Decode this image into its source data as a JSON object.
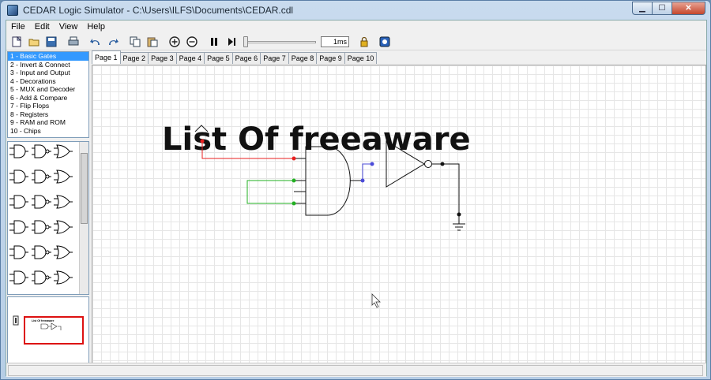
{
  "window": {
    "title": "CEDAR Logic Simulator - C:\\Users\\ILFS\\Documents\\CEDAR.cdl"
  },
  "menu": [
    "File",
    "Edit",
    "View",
    "Help"
  ],
  "toolbar": {
    "icons": [
      "new-icon",
      "open-icon",
      "save-icon",
      "print-icon",
      "undo-icon",
      "redo-icon",
      "copy-icon",
      "paste-icon",
      "zoom-in-icon",
      "zoom-out-icon",
      "pause-icon",
      "step-icon"
    ],
    "speed": "1ms",
    "slider_value": 0
  },
  "categories": [
    "1  - Basic Gates",
    "2  - Invert & Connect",
    "3  - Input and Output",
    "4  - Decorations",
    "5  - MUX and Decoder",
    "6  - Add & Compare",
    "7  - Flip Flops",
    "8  - Registers",
    "9  - RAM and ROM",
    "10 - Chips"
  ],
  "tabs": [
    "Page 1",
    "Page 2",
    "Page 3",
    "Page 4",
    "Page 5",
    "Page 6",
    "Page 7",
    "Page 8",
    "Page 9",
    "Page 10"
  ],
  "active_tab": 0,
  "canvas": {
    "label": "List Of freeaware"
  },
  "preview": {
    "label": "List Of freeaware"
  },
  "colors": {
    "wire_red": "#e82020",
    "wire_green": "#22b022",
    "wire_blue": "#4b4bd8",
    "selection": "#3399ff",
    "preview_frame": "#dd1111"
  }
}
